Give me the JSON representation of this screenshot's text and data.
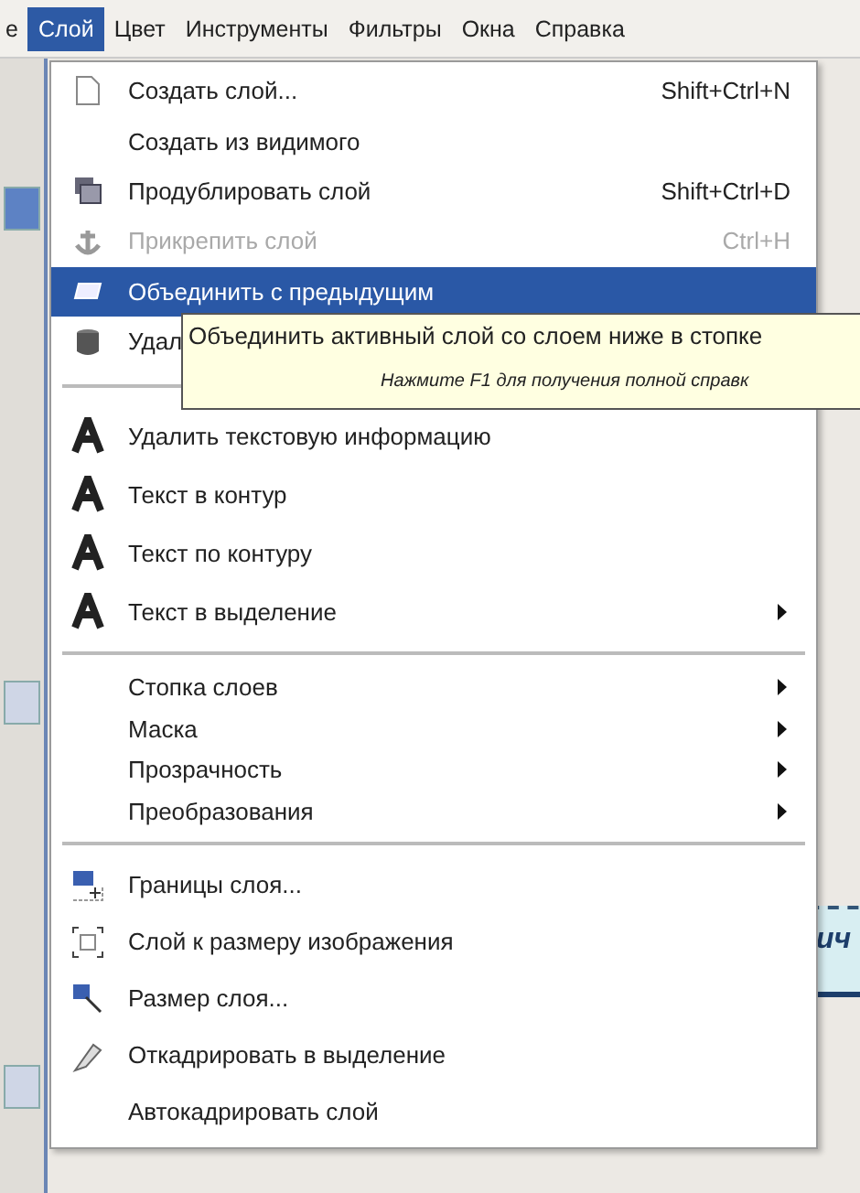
{
  "menubar": {
    "items": [
      {
        "label": "е",
        "selected": false
      },
      {
        "label": "Слой",
        "selected": true
      },
      {
        "label": "Цвет",
        "selected": false
      },
      {
        "label": "Инструменты",
        "selected": false
      },
      {
        "label": "Фильтры",
        "selected": false
      },
      {
        "label": "Окна",
        "selected": false
      },
      {
        "label": "Справка",
        "selected": false
      }
    ]
  },
  "menu": {
    "groups": [
      {
        "items": [
          {
            "label": "Создать слой...",
            "shortcut": "Shift+Ctrl+N",
            "disabled": false,
            "selected": false,
            "submenu": false
          },
          {
            "label": "Создать из видимого",
            "disabled": false,
            "selected": false,
            "submenu": false
          },
          {
            "label": "Продублировать слой",
            "shortcut": "Shift+Ctrl+D",
            "disabled": false,
            "selected": false,
            "submenu": false
          },
          {
            "label": "Прикрепить слой",
            "shortcut": "Ctrl+H",
            "disabled": true,
            "selected": false,
            "submenu": false
          },
          {
            "label": "Объединить с предыдущим",
            "disabled": false,
            "selected": true,
            "submenu": false
          },
          {
            "label": "Удал",
            "disabled": false,
            "selected": false
          }
        ]
      },
      {
        "items": [
          {
            "label": "Удалить текстовую информацию",
            "disabled": false,
            "selected": false,
            "submenu": false
          },
          {
            "label": "Текст в контур",
            "disabled": false,
            "selected": false,
            "submenu": false
          },
          {
            "label": "Текст по контуру",
            "disabled": false,
            "selected": false,
            "submenu": false
          },
          {
            "label": "Текст в выделение",
            "disabled": false,
            "selected": false,
            "submenu": true
          }
        ]
      },
      {
        "items": [
          {
            "label": "Стопка слоев",
            "disabled": false,
            "selected": false,
            "submenu": true
          },
          {
            "label": "Маска",
            "disabled": false,
            "selected": false,
            "submenu": true
          },
          {
            "label": "Прозрачность",
            "disabled": false,
            "selected": false,
            "submenu": true
          },
          {
            "label": "Преобразования",
            "disabled": false,
            "selected": false,
            "submenu": true
          }
        ]
      },
      {
        "items": [
          {
            "label": "Границы слоя...",
            "disabled": false,
            "selected": false,
            "submenu": false
          },
          {
            "label": "Слой к размеру изображения",
            "disabled": false,
            "selected": false,
            "submenu": false
          },
          {
            "label": "Размер слоя...",
            "disabled": false,
            "selected": false,
            "submenu": false
          },
          {
            "label": "Откадрировать в выделение",
            "disabled": false,
            "selected": false,
            "submenu": false
          },
          {
            "label": "Автокадрировать слой",
            "disabled": false,
            "selected": false,
            "submenu": false
          }
        ]
      }
    ]
  },
  "tooltip": {
    "text": "Объединить активный слой со слоем ниже в стопке",
    "hint": "Нажмите F1 для получения полной справк"
  },
  "canvas": {
    "text": "ич"
  }
}
